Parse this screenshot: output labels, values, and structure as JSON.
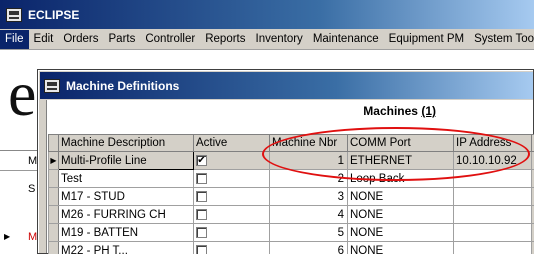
{
  "app": {
    "title": "ECLIPSE",
    "background_letter": "e"
  },
  "menu": {
    "items": [
      {
        "label": "File",
        "active": true
      },
      {
        "label": "Edit"
      },
      {
        "label": "Orders"
      },
      {
        "label": "Parts"
      },
      {
        "label": "Controller"
      },
      {
        "label": "Reports"
      },
      {
        "label": "Inventory"
      },
      {
        "label": "Maintenance"
      },
      {
        "label": "Equipment PM"
      },
      {
        "label": "System Tools"
      }
    ]
  },
  "background_grid": {
    "cells": [
      "M",
      "S",
      "M"
    ]
  },
  "dialog": {
    "title": "Machine Definitions",
    "section_title": "Machines",
    "section_count": "(1)",
    "columns": {
      "description": "Machine Description",
      "active": "Active",
      "number": "Machine Nbr",
      "comm_port": "COMM Port",
      "ip_address": "IP Address"
    },
    "rows": [
      {
        "description": "Multi-Profile Line",
        "active": true,
        "number": "1",
        "comm_port": "ETHERNET",
        "ip": "10.10.10.92",
        "selected": true
      },
      {
        "description": "Test",
        "active": false,
        "number": "2",
        "comm_port": "Loop Back",
        "ip": ""
      },
      {
        "description": "M17 - STUD",
        "active": false,
        "number": "3",
        "comm_port": "NONE",
        "ip": ""
      },
      {
        "description": "M26 - FURRING CH",
        "active": false,
        "number": "4",
        "comm_port": "NONE",
        "ip": ""
      },
      {
        "description": "M19 - BATTEN",
        "active": false,
        "number": "5",
        "comm_port": "NONE",
        "ip": ""
      },
      {
        "description": "M22 - PH T...",
        "active": false,
        "number": "6",
        "comm_port": "NONE",
        "ip": ""
      }
    ]
  },
  "colors": {
    "titlebar": "#0a246a",
    "highlight": "#e01010"
  }
}
